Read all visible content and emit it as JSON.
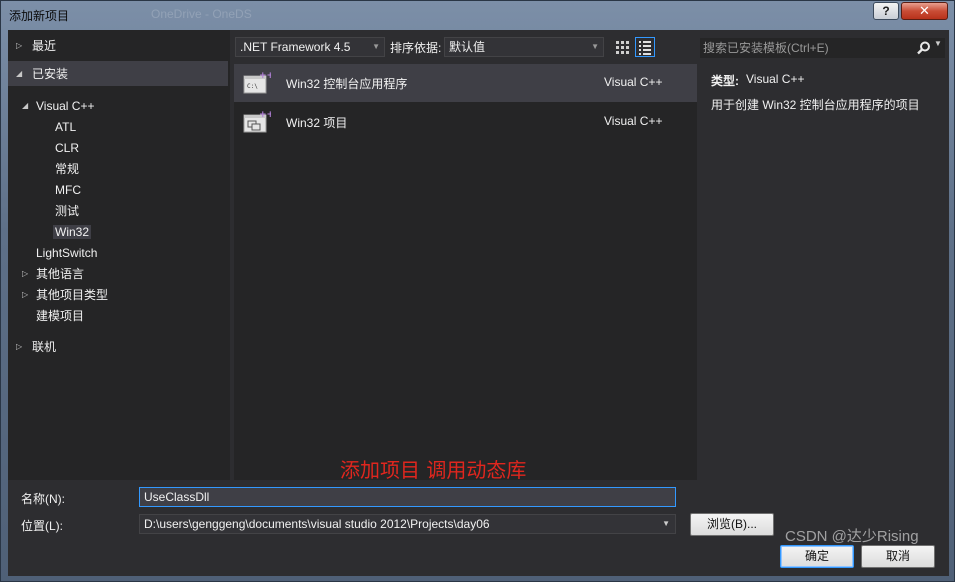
{
  "window": {
    "title": "添加新项目",
    "background_title": "OneDrive - OneDS",
    "help_label": "?",
    "close_label": "✕"
  },
  "tree": {
    "recent": "最近",
    "installed": "已安装",
    "visual_cpp": "Visual C++",
    "children": [
      "ATL",
      "CLR",
      "常规",
      "MFC",
      "测试",
      "Win32"
    ],
    "selected_child": "Win32",
    "lightswitch": "LightSwitch",
    "other_languages": "其他语言",
    "other_project_types": "其他项目类型",
    "modeling_projects": "建模项目",
    "online": "联机"
  },
  "toolbar": {
    "framework": ".NET Framework 4.5",
    "sort_label": "排序依据:",
    "sort_value": "默认值"
  },
  "search": {
    "placeholder": "搜索已安装模板(Ctrl+E)"
  },
  "templates": [
    {
      "name": "Win32 控制台应用程序",
      "language": "Visual C++",
      "icon": "console-app-icon",
      "selected": true
    },
    {
      "name": "Win32 项目",
      "language": "Visual C++",
      "icon": "win32-project-icon",
      "selected": false
    }
  ],
  "description": {
    "type_label": "类型:",
    "type_value": "Visual C++",
    "text": "用于创建 Win32 控制台应用程序的项目"
  },
  "annotation": "添加项目 调用动态库",
  "form": {
    "name_label": "名称(N):",
    "name_value": "UseClassDll",
    "location_label": "位置(L):",
    "location_value": "D:\\users\\genggeng\\documents\\visual studio 2012\\Projects\\day06",
    "browse_label": "浏览(B)...",
    "ok_label": "确定",
    "cancel_label": "取消"
  },
  "watermark": "CSDN @达少Rising",
  "colors": {
    "background": "#2d2d30",
    "panel": "#252526",
    "selection": "#3f3f46",
    "accent": "#3399ff",
    "annotation": "#e0261e"
  }
}
